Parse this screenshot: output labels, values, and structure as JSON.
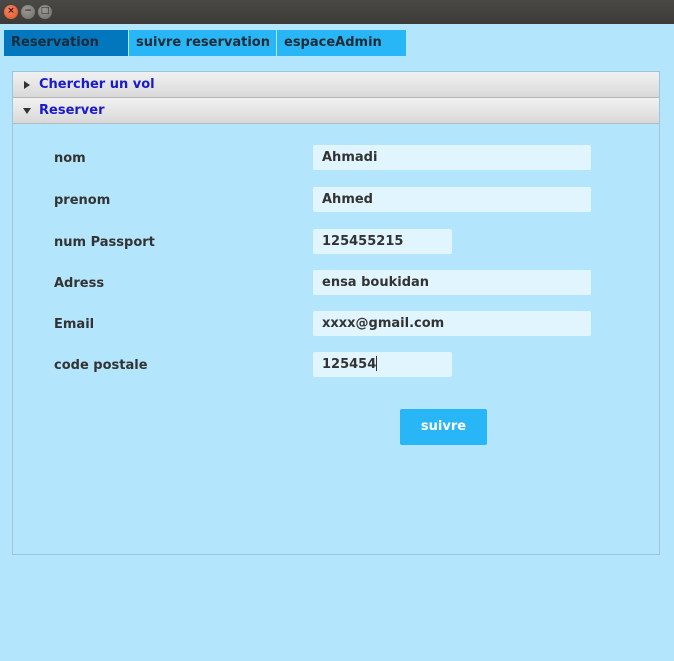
{
  "window": {
    "close_glyph": "×",
    "minimize_glyph": "−",
    "maximize_glyph": "□"
  },
  "tabs": [
    {
      "label": "Reservation",
      "selected": true
    },
    {
      "label": "suivre reservation",
      "selected": false
    },
    {
      "label": "espaceAdmin",
      "selected": false
    }
  ],
  "accordion": {
    "panes": [
      {
        "title": "Chercher un vol",
        "expanded": false
      },
      {
        "title": "Reserver",
        "expanded": true
      }
    ]
  },
  "form": {
    "nom": {
      "label": "nom",
      "value": "Ahmadi"
    },
    "prenom": {
      "label": "prenom",
      "value": "Ahmed"
    },
    "passport": {
      "label": "num Passport",
      "value": "125455215"
    },
    "adress": {
      "label": "Adress",
      "value": "ensa boukidan"
    },
    "email": {
      "label": "Email",
      "value": "xxxx@gmail.com"
    },
    "code_postale": {
      "label": "code postale",
      "value": "125454"
    },
    "submit_label": "suivre"
  },
  "colors": {
    "background": "#b3e5fc",
    "tab_selected": "#0277bd",
    "tab": "#29b6f6",
    "field": "#e1f5fe",
    "button": "#29b6f6",
    "pane_title_text": "#1a1acd"
  }
}
